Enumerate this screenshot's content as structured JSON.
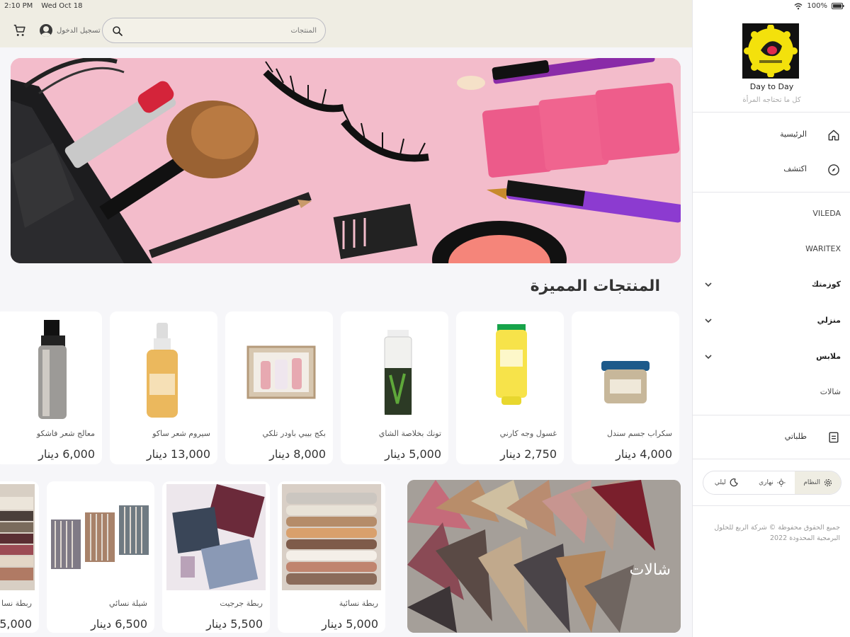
{
  "status": {
    "time": "2:10 PM",
    "date": "Wed Oct 18",
    "battery": "100%"
  },
  "header": {
    "login_label": "تسجيل الدخول",
    "search_placeholder": "المنتجات"
  },
  "featured": {
    "title": "المنتجات المميزة",
    "products": [
      {
        "name": "سكراب جسم سندل",
        "price": "4,000 دينار"
      },
      {
        "name": "غسول وجه كارني",
        "price": "2,750 دينار"
      },
      {
        "name": "تونك بخلاصة الشاي",
        "price": "5,000 دينار"
      },
      {
        "name": "بكج بيبي باودر تلكي",
        "price": "8,000 دينار"
      },
      {
        "name": "سيروم شعر ساكو",
        "price": "13,000 دينار"
      },
      {
        "name": "معالج شعر فاشكو",
        "price": "6,000 دينار"
      }
    ]
  },
  "category_banner": {
    "label": "شالات"
  },
  "scarves": [
    {
      "name": "ربطة نسائية",
      "price": "5,000 دينار"
    },
    {
      "name": "ربطة جرجيت",
      "price": "5,500 دينار"
    },
    {
      "name": "شيلة نسائي",
      "price": "6,500 دينار"
    },
    {
      "name": "ربطة نسا",
      "price": "5,000"
    }
  ],
  "sidebar": {
    "brand": "Day to Day",
    "tagline": "كل ما تحتاجه المرأة",
    "nav": [
      {
        "label": "الرئيسية",
        "icon": "home-icon"
      },
      {
        "label": "اكتشف",
        "icon": "compass-icon"
      }
    ],
    "categories": [
      {
        "label": "VILEDA",
        "expandable": false
      },
      {
        "label": "WARITEX",
        "expandable": false
      },
      {
        "label": "كوزمتك",
        "expandable": true
      },
      {
        "label": "منزلي",
        "expandable": true
      },
      {
        "label": "ملابس",
        "expandable": true
      },
      {
        "label": "شالات",
        "expandable": false
      }
    ],
    "orders_label": "طلباتي",
    "theme": {
      "system": "النظام",
      "light": "نهاري",
      "dark": "ليلي"
    },
    "footer": "جميع الحقوق محفوظة © شركة الربع للحلول البرمجية المحدودة 2022"
  }
}
